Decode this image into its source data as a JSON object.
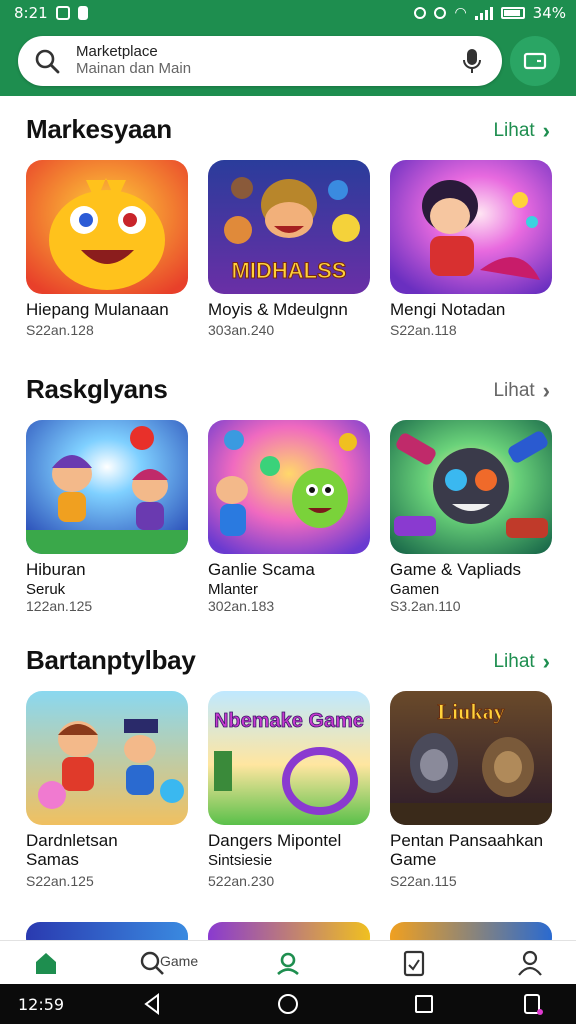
{
  "status_bar": {
    "time": "8:21",
    "battery": "34%"
  },
  "search": {
    "text": "Marketplace",
    "subtext": "Mainan dan Main"
  },
  "sections": [
    {
      "title": "Markesyaan",
      "more_label": "Lihat",
      "more_color": "#1e8e4f",
      "items": [
        {
          "name": "Hiepang Mulanaan",
          "meta": "S22an.128",
          "icon": "yellow-monster-art"
        },
        {
          "name": "Moyis & Mdeulgnn",
          "meta": "303an.240",
          "icon": "heroes-art",
          "thumb_text": "MIDHALSS"
        },
        {
          "name": "Mengi Notadan",
          "meta": "S22an.118",
          "icon": "girl-hero-art"
        }
      ]
    },
    {
      "title": "Raskglyans",
      "more_label": "Lihat",
      "more_color": "#666666",
      "items": [
        {
          "name": "Hiburan",
          "name2": "Seruk",
          "meta": "122an.125",
          "icon": "kids-adventure-art"
        },
        {
          "name": "Ganlie Scama",
          "name2": "Mlanter",
          "meta": "302an.183",
          "icon": "green-monster-art"
        },
        {
          "name": "Game & Vapliads",
          "name2": "Gamen",
          "meta": "S3.2an.110",
          "icon": "robot-bug-art"
        }
      ]
    },
    {
      "title": "Bartanptylbay",
      "more_label": "Lihat",
      "more_color": "#1e8e4f",
      "items": [
        {
          "name": "Dardnletsan",
          "name2": "Samas",
          "meta": "S22an.125",
          "icon": "party-kids-art"
        },
        {
          "name": "Dangers Mipontel",
          "name2": "Sintsiesie",
          "meta": "522an.230",
          "icon": "track-game-art",
          "thumb_text": "Nbemake Game"
        },
        {
          "name": "Pentan Pansaahkan",
          "name2": "Game",
          "meta": "S22an.115",
          "icon": "warriors-art",
          "thumb_text": "Liukay"
        }
      ]
    }
  ],
  "bottom_nav": {
    "search_label": "Game"
  },
  "system_nav": {
    "time": "12:59"
  }
}
